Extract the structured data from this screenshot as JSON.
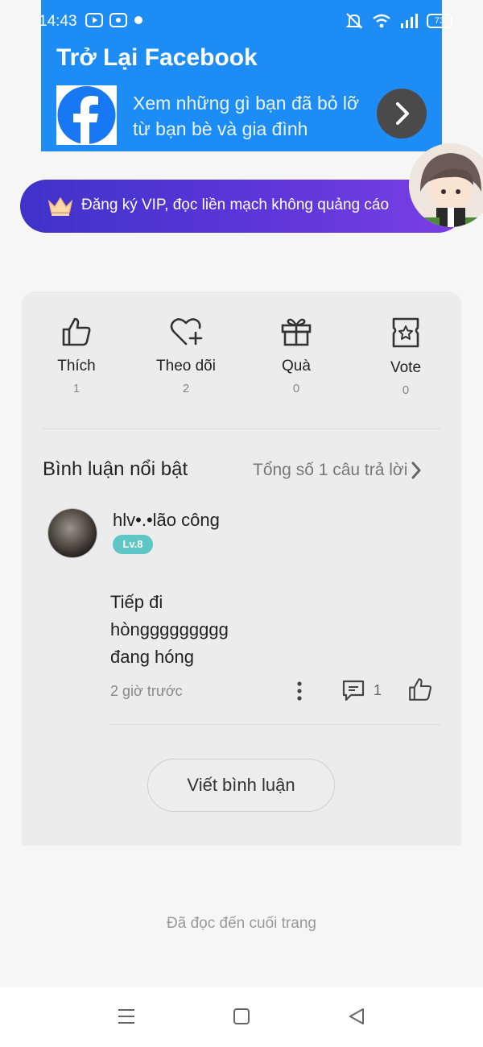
{
  "status_bar": {
    "time": "14:43",
    "battery": "73"
  },
  "ad_banner": {
    "title": "Trở Lại Facebook",
    "line1": "Xem những gì bạn đã bỏ lỡ",
    "line2": "từ bạn bè và gia đình",
    "brand_color": "#1d8df5"
  },
  "vip": {
    "label": "Đăng ký VIP, đọc liền mạch không quảng cáo"
  },
  "actions": [
    {
      "label": "Thích",
      "count": "1",
      "icon": "thumbs-up-icon"
    },
    {
      "label": "Theo dõi",
      "count": "2",
      "icon": "heart-plus-icon"
    },
    {
      "label": "Quà",
      "count": "0",
      "icon": "gift-icon"
    },
    {
      "label": "Vote",
      "count": "0",
      "icon": "ticket-star-icon"
    }
  ],
  "comments_section": {
    "title": "Bình luận nổi bật",
    "total_replies": "Tổng số 1 câu trả lời"
  },
  "comment": {
    "username": "hlv•.•lão công",
    "level": "Lv.8",
    "body": "Tiếp đi\nhònggggggggg\nđang hóng",
    "time": "2 giờ trước",
    "reply_count": "1"
  },
  "write_comment_label": "Viết bình luận",
  "end_of_page": "Đã đọc đến cuối trang"
}
